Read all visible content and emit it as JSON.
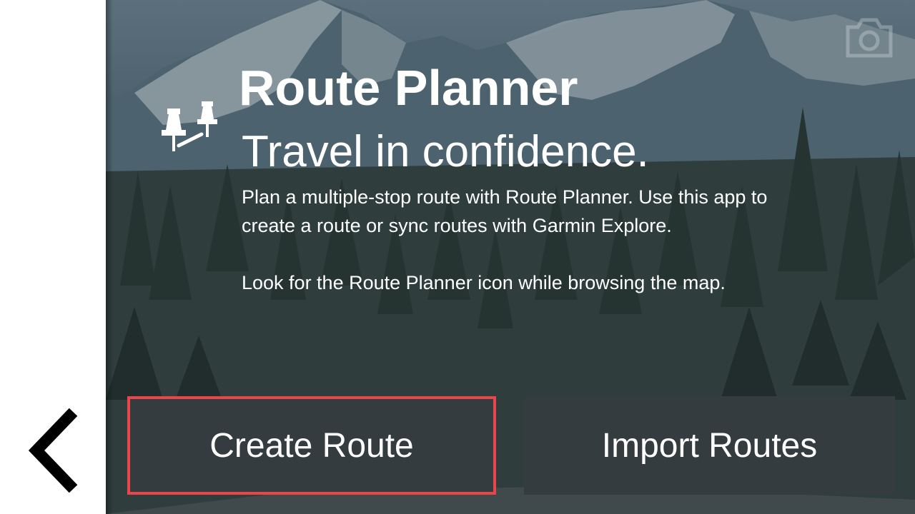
{
  "header": {
    "title": "Route Planner",
    "subtitle": "Travel in confidence."
  },
  "description": {
    "paragraph_1": "Plan a multiple-stop route with Route Planner. Use this app to create a route or sync routes with Garmin Explore.",
    "paragraph_2": "Look for the Route Planner icon while browsing the map."
  },
  "actions": {
    "create_label": "Create Route",
    "import_label": "Import Routes"
  },
  "icons": {
    "back": "chevron-left-icon",
    "app": "route-planner-pins-icon",
    "camera": "camera-icon"
  },
  "colors": {
    "highlight_border": "#e8464a",
    "button_background": "#343c40",
    "text": "#ffffff"
  }
}
